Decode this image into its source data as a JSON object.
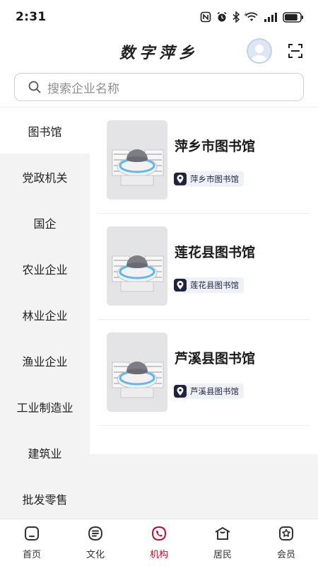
{
  "status_bar": {
    "time": "2:31",
    "network_label": "6",
    "battery_level": 0.85
  },
  "header": {
    "title": "数字萍乡"
  },
  "search": {
    "placeholder": "搜索企业名称"
  },
  "sidebar": {
    "items": [
      {
        "label": "图书馆",
        "active": true
      },
      {
        "label": "党政机关"
      },
      {
        "label": "国企"
      },
      {
        "label": "农业企业"
      },
      {
        "label": "林业企业"
      },
      {
        "label": "渔业企业"
      },
      {
        "label": "工业制造业"
      },
      {
        "label": "建筑业"
      },
      {
        "label": "批发零售"
      }
    ]
  },
  "list": {
    "items": [
      {
        "title": "萍乡市图书馆",
        "tag": "萍乡市图书馆"
      },
      {
        "title": "莲花县图书馆",
        "tag": "莲花县图书馆"
      },
      {
        "title": "芦溪县图书馆",
        "tag": "芦溪县图书馆"
      }
    ]
  },
  "tabbar": {
    "items": [
      {
        "label": "首页",
        "icon": "home-icon"
      },
      {
        "label": "文化",
        "icon": "culture-icon"
      },
      {
        "label": "机构",
        "icon": "institution-icon",
        "active": true
      },
      {
        "label": "居民",
        "icon": "resident-icon"
      },
      {
        "label": "会员",
        "icon": "member-icon"
      }
    ]
  },
  "colors": {
    "accent": "#b5102d",
    "tag_bg": "#eef2f7",
    "sidebar_bg": "#f3f3f3"
  }
}
